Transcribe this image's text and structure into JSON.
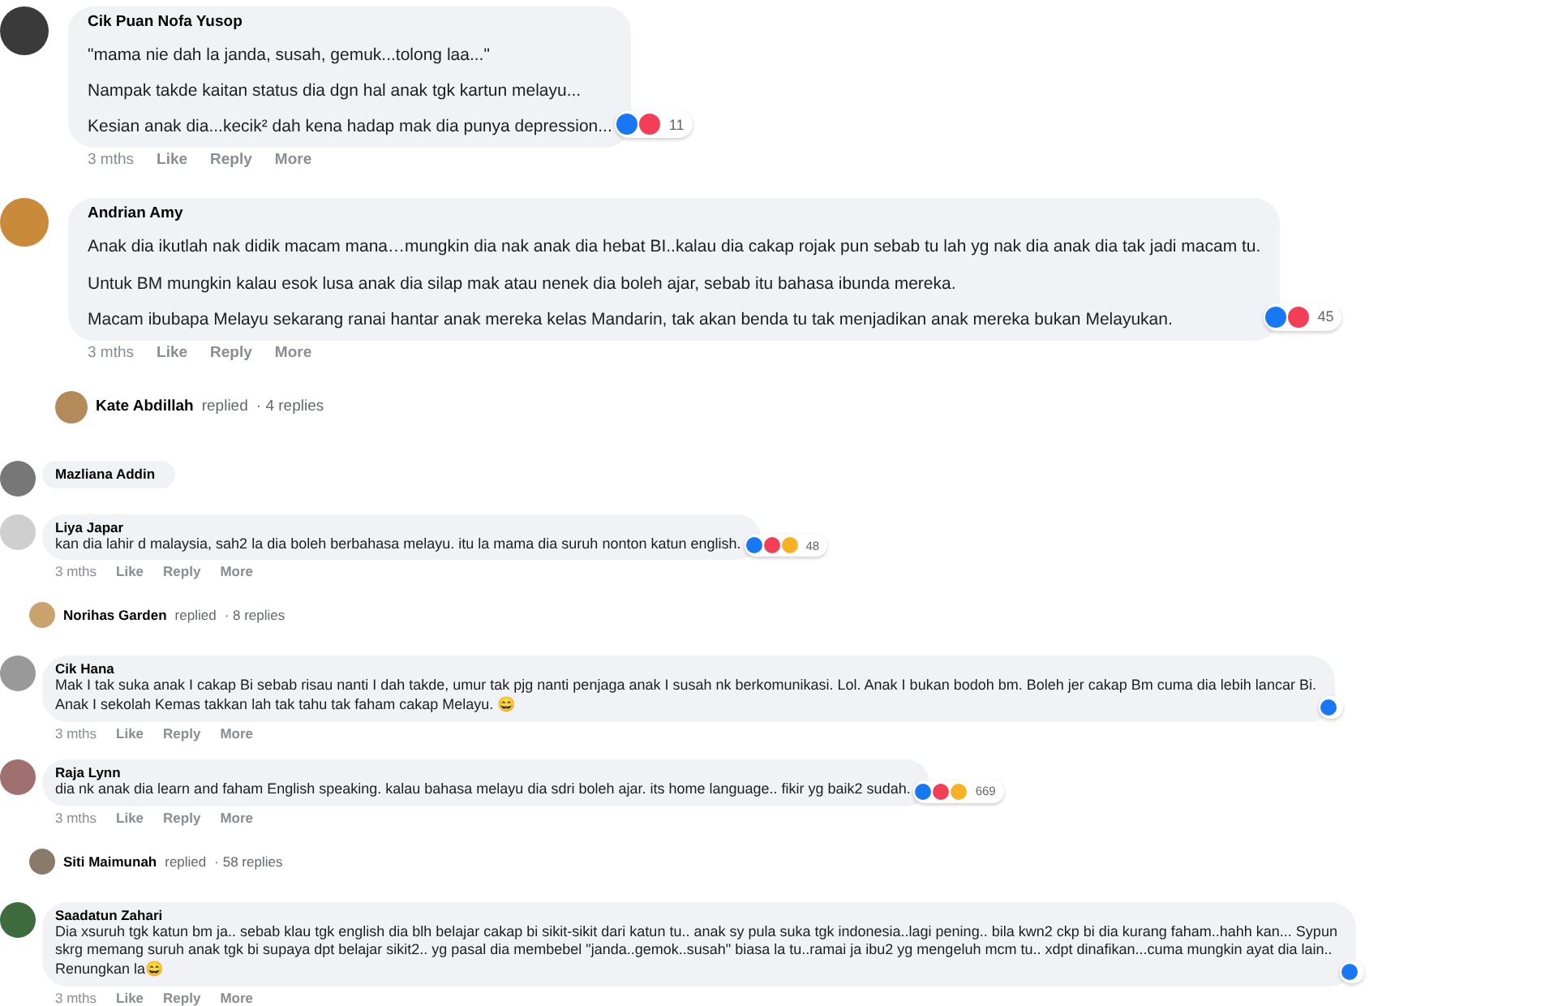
{
  "threads": [
    {
      "kind": "comment",
      "compact": false,
      "name": "Cik Puan Nofa Yusop",
      "paragraphs": [
        [
          "\"mama nie dah la janda, susah, gemuk...tolong laa...\""
        ],
        [
          "Nampak takde kaitan status dia dgn hal anak tgk kartun melayu..."
        ],
        [
          "Kesian anak dia...kecik² dah kena hadap mak dia punya depression..."
        ]
      ],
      "reactions": [
        {
          "kind": "like"
        },
        {
          "kind": "love"
        }
      ],
      "count": "11",
      "time": "3 mths",
      "actions": [
        "Like",
        "Reply",
        "More"
      ]
    },
    {
      "kind": "comment",
      "compact": false,
      "name": "Andrian Amy",
      "paragraphs": [
        [
          "Anak dia ikutlah nak didik macam mana…mungkin dia nak anak dia hebat BI..kalau dia cakap rojak pun sebab tu lah yg nak dia anak dia tak jadi macam tu."
        ],
        [
          "Untuk BM mungkin kalau esok lusa anak dia silap mak atau nenek dia boleh ajar, sebab itu bahasa ibunda mereka."
        ],
        [
          "Macam ibubapa Melayu sekarang ranai hantar anak mereka kelas Mandarin, tak akan benda tu tak menjadikan anak mereka bukan Melayukan."
        ]
      ],
      "reactions": [
        {
          "kind": "like"
        },
        {
          "kind": "love"
        }
      ],
      "count": "45",
      "time": "3 mths",
      "actions": [
        "Like",
        "Reply",
        "More"
      ]
    },
    {
      "kind": "replies",
      "compact": false,
      "name": "Kate Abdillah",
      "verb": "replied",
      "count": "· 4 replies"
    },
    {
      "kind": "cut",
      "compact": true,
      "name": "Mazliana Addin"
    },
    {
      "kind": "comment",
      "compact": true,
      "name": "Liya Japar",
      "paragraphs": [
        [
          "kan dia lahir d malaysia, sah2 la dia boleh berbahasa melayu. itu la mama dia suruh nonton katun english."
        ]
      ],
      "reactions": [
        {
          "kind": "like"
        },
        {
          "kind": "love"
        },
        {
          "kind": "haha"
        }
      ],
      "count": "48",
      "time": "3 mths",
      "actions": [
        "Like",
        "Reply",
        "More"
      ]
    },
    {
      "kind": "replies",
      "compact": true,
      "name": "Norihas Garden",
      "verb": "replied",
      "count": "· 8 replies"
    },
    {
      "kind": "comment",
      "compact": true,
      "name": "Cik Hana",
      "paragraphs": [
        [
          "Mak I tak suka anak I cakap Bi sebab risau nanti I dah takde, umur tak pjg nanti penjaga anak I susah nk berkomunikasi. Lol. Anak I bukan bodoh bm. Boleh jer cakap Bm cuma dia lebih lancar Bi.",
          "Anak I sekolah Kemas takkan lah tak tahu tak faham cakap Melayu. 😄"
        ]
      ],
      "reactions": [
        {
          "kind": "like"
        }
      ],
      "time": "3 mths",
      "actions": [
        "Like",
        "Reply",
        "More"
      ]
    },
    {
      "kind": "comment",
      "compact": true,
      "name": "Raja Lynn",
      "paragraphs": [
        [
          "dia nk anak dia learn and faham English speaking. kalau bahasa melayu dia sdri boleh ajar. its home language.. fikir yg baik2 sudah."
        ]
      ],
      "reactions": [
        {
          "kind": "like"
        },
        {
          "kind": "love"
        },
        {
          "kind": "haha"
        }
      ],
      "count": "669",
      "time": "3 mths",
      "actions": [
        "Like",
        "Reply",
        "More"
      ]
    },
    {
      "kind": "replies",
      "compact": true,
      "name": "Siti Maimunah",
      "verb": "replied",
      "count": "· 58 replies"
    },
    {
      "kind": "comment",
      "compact": true,
      "name": "Saadatun Zahari",
      "paragraphs": [
        [
          "Dia xsuruh tgk katun bm ja.. sebab klau tgk english dia blh belajar cakap bi sikit-sikit dari katun tu.. anak sy pula suka tgk indonesia..lagi pening.. bila kwn2 ckp bi dia kurang faham..hahh kan... Sypun",
          "skrg memang suruh anak tgk bi supaya dpt belajar sikit2.. yg pasal dia membebel \"janda..gemok..susah\" biasa la tu..ramai ja ibu2 yg mengeluh mcm tu.. xdpt dinafikan...cuma mungkin ayat dia lain..",
          "Renungkan la😄"
        ]
      ],
      "reactions": [
        {
          "kind": "like"
        }
      ],
      "time": "3 mths",
      "actions": [
        "Like",
        "Reply",
        "More"
      ]
    }
  ]
}
